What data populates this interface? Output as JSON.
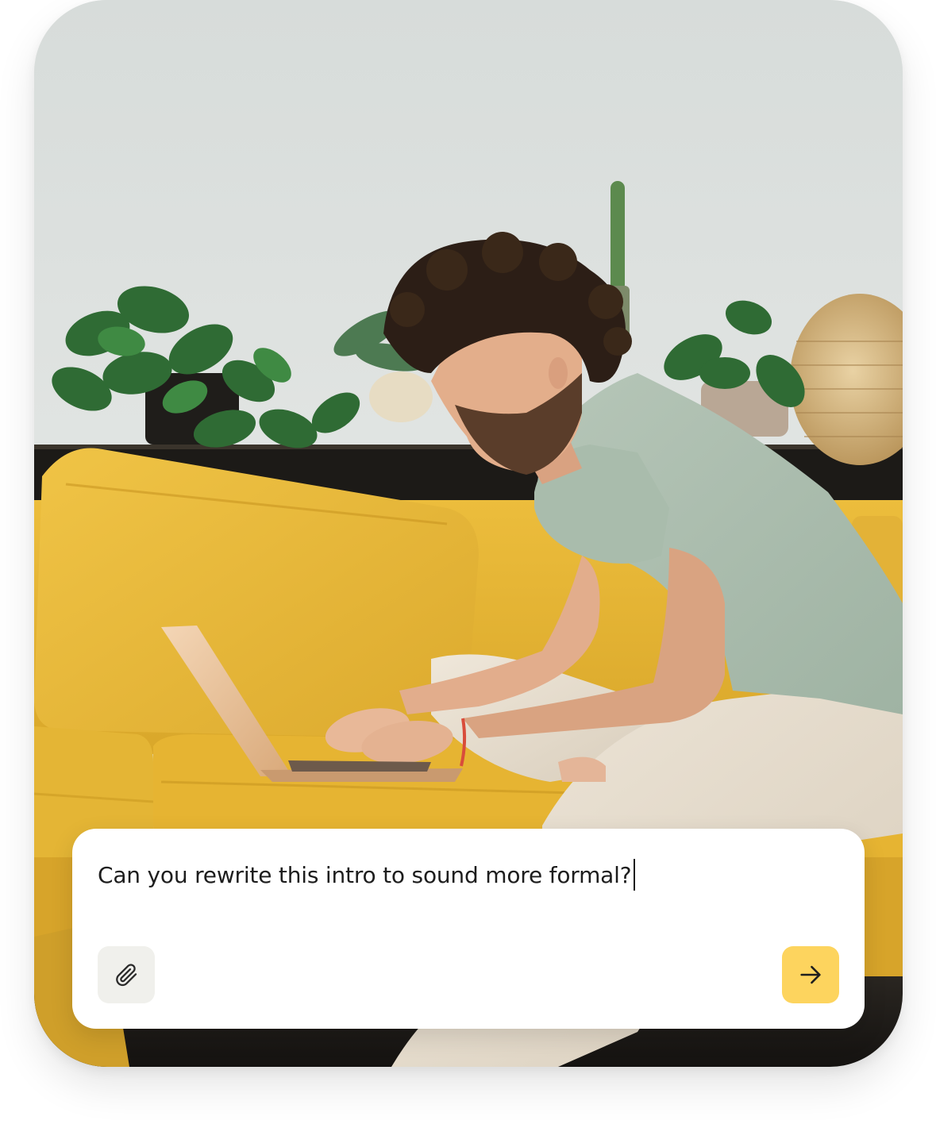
{
  "composer": {
    "prompt_text": "Can you rewrite this intro to sound more formal?",
    "attach_icon": "paperclip-icon",
    "send_icon": "arrow-right-icon",
    "send_color": "#fdd45e",
    "attach_bg_color": "#f0f0ec"
  },
  "photo": {
    "subject": "person-typing-on-laptop-on-yellow-sofa",
    "sofa_color": "#e8b735",
    "shirt_color": "#aebfb0",
    "wall_color": "#dde1df"
  }
}
